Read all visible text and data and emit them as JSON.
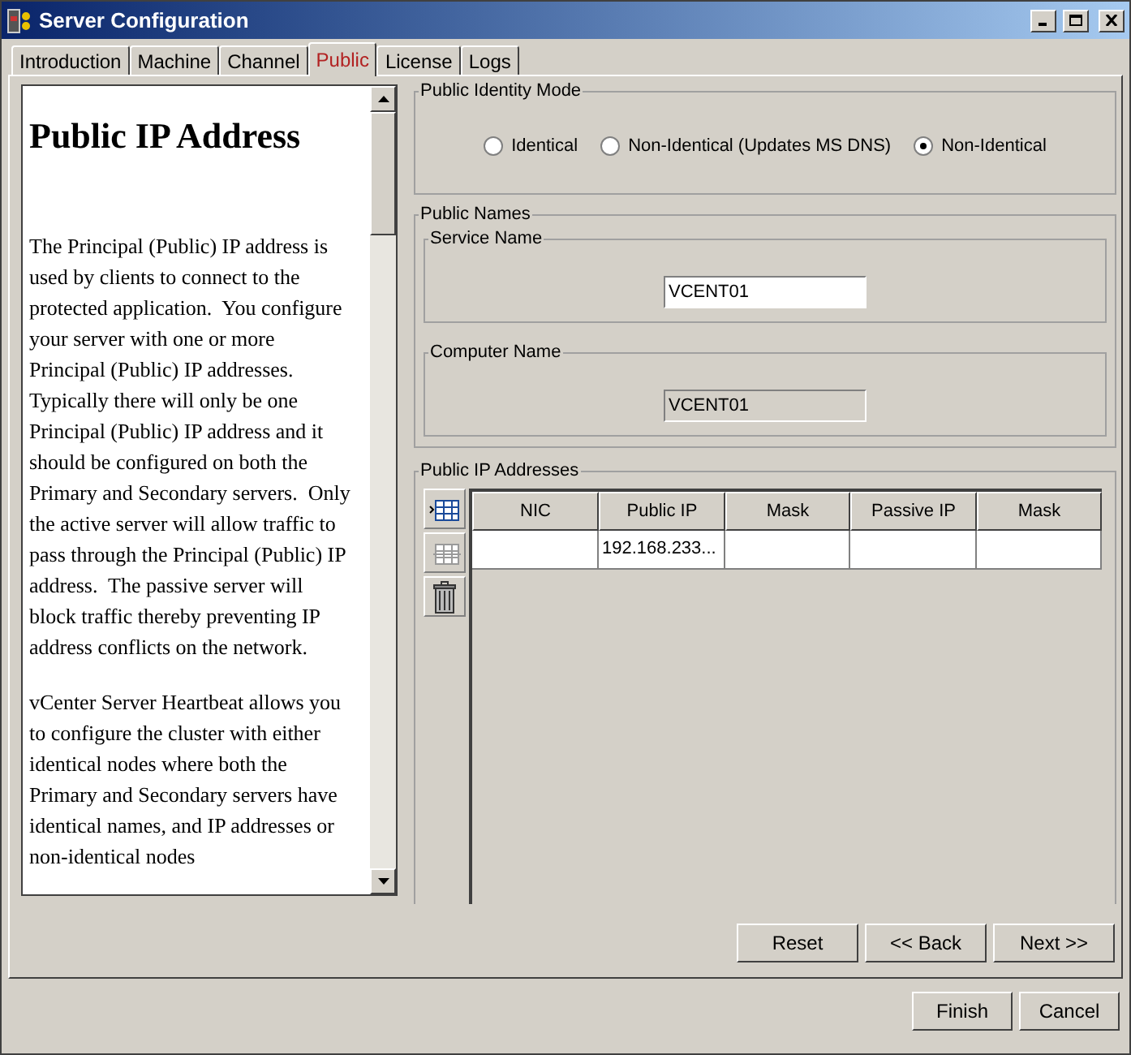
{
  "window": {
    "title": "Server Configuration"
  },
  "tabs": [
    {
      "label": "Introduction",
      "selected": false
    },
    {
      "label": "Machine",
      "selected": false
    },
    {
      "label": "Channel",
      "selected": false
    },
    {
      "label": "Public",
      "selected": true
    },
    {
      "label": "License",
      "selected": false
    },
    {
      "label": "Logs",
      "selected": false
    }
  ],
  "help": {
    "heading": "Public IP Address",
    "paragraphs": [
      "The Principal (Public) IP address is used by clients to connect to the protected application.  You configure your server with one or more Principal (Public) IP addresses.  Typically there will only be one Principal (Public) IP address and it should be configured on both the Primary and Secondary servers.  Only the active server will allow traffic to pass through the Principal (Public) IP address.  The passive server will block traffic thereby preventing IP address conflicts on the network.",
      "vCenter Server Heartbeat allows you to configure the cluster with either identical nodes where both the Primary and Secondary servers have identical names, and IP addresses or non-identical nodes"
    ]
  },
  "identity_mode": {
    "title": "Public Identity Mode",
    "options": [
      {
        "label": "Identical",
        "selected": false
      },
      {
        "label": "Non-Identical (Updates MS DNS)",
        "selected": false
      },
      {
        "label": "Non-Identical",
        "selected": true
      }
    ]
  },
  "public_names": {
    "title": "Public Names",
    "fields": [
      {
        "label": "Service Name",
        "value": "VCENT01",
        "disabled": false
      },
      {
        "label": "Computer Name",
        "value": "VCENT01",
        "disabled": true
      }
    ]
  },
  "ip_addresses": {
    "title": "Public IP Addresses",
    "toolbar": [
      {
        "kind": "add",
        "disabled": false
      },
      {
        "kind": "remove",
        "disabled": true
      },
      {
        "kind": "delete",
        "disabled": false
      }
    ],
    "columns": [
      "NIC",
      "Public IP",
      "Mask",
      "Passive IP",
      "Mask"
    ],
    "rows": [
      [
        "",
        "192.168.233...",
        "",
        "",
        ""
      ]
    ]
  },
  "page_buttons": [
    "Reset",
    "<< Back",
    "Next >>"
  ],
  "dialog_buttons": [
    "Finish",
    "Cancel"
  ]
}
